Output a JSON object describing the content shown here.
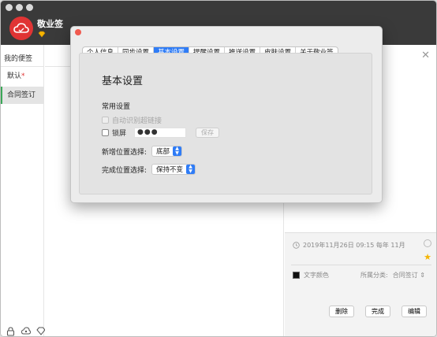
{
  "app": {
    "name": "敬业签"
  },
  "sidebar": {
    "title": "我的便签",
    "items": [
      {
        "label": "默认",
        "marker": "*"
      },
      {
        "label": "合同签订"
      }
    ],
    "bottom_icons": [
      "lock-icon",
      "cloud-people-icon",
      "diamond-icon",
      "cloud-icon",
      "settings-icon"
    ]
  },
  "detail": {
    "close_glyph": "✕",
    "date_text": "2019年11月26日 09:15 每年 11月",
    "color_label": "文字颜色",
    "category_label": "所属分类:",
    "category_value": "合同签订",
    "buttons": {
      "delete": "删除",
      "done": "完成",
      "edit": "编辑"
    }
  },
  "dialog": {
    "tabs": [
      {
        "label": "个人信息",
        "active": false
      },
      {
        "label": "同步设置",
        "active": false
      },
      {
        "label": "基本设置",
        "active": true
      },
      {
        "label": "提醒设置",
        "active": false
      },
      {
        "label": "推送设置",
        "active": false
      },
      {
        "label": "皮肤设置",
        "active": false
      },
      {
        "label": "关于敬业签",
        "active": false
      }
    ],
    "section_title": "基本设置",
    "common_settings_label": "常用设置",
    "auto_link_label": "自动识别超链接",
    "lock_label": "锁屏",
    "password_value": "●●●",
    "save_label": "保存",
    "new_position_label": "新增位置选择:",
    "new_position_value": "底部",
    "done_position_label": "完成位置选择:",
    "done_position_value": "保持不变"
  },
  "colors": {
    "accent": "#2f7cf6",
    "brand": "#e03434",
    "titlebar": "#3a3a3a",
    "selected_marker": "#3aa757"
  }
}
